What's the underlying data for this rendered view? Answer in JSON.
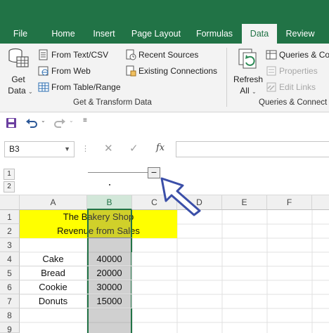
{
  "tabs": [
    {
      "label": "File",
      "active": false
    },
    {
      "label": "Home",
      "active": false
    },
    {
      "label": "Insert",
      "active": false
    },
    {
      "label": "Page Layout",
      "active": false
    },
    {
      "label": "Formulas",
      "active": false
    },
    {
      "label": "Data",
      "active": true
    },
    {
      "label": "Review",
      "active": false
    }
  ],
  "ribbon": {
    "get_data_line1": "Get",
    "get_data_line2": "Data",
    "from_text_csv": "From Text/CSV",
    "from_web": "From Web",
    "from_table_range": "From Table/Range",
    "recent_sources": "Recent Sources",
    "existing_connections": "Existing Connections",
    "group_get_transform": "Get & Transform Data",
    "refresh_line1": "Refresh",
    "refresh_line2": "All",
    "queries_connections": "Queries & Co",
    "properties": "Properties",
    "edit_links": "Edit Links",
    "group_queries": "Queries & Connect"
  },
  "formula_bar": {
    "name_box": "B3",
    "fx_label": "fx"
  },
  "outline": {
    "levels": [
      "1",
      "2"
    ],
    "collapse_symbol": "−"
  },
  "columns": [
    "A",
    "B",
    "C",
    "D",
    "E",
    "F"
  ],
  "rows": [
    "1",
    "2",
    "3",
    "4",
    "5",
    "6",
    "7",
    "8",
    "9"
  ],
  "sheet": {
    "title1": "The Bakery Shop",
    "title2": "Revenue from Sales",
    "items": [
      {
        "name": "Cake",
        "value": "40000"
      },
      {
        "name": "Bread",
        "value": "20000"
      },
      {
        "name": "Cookie",
        "value": "30000"
      },
      {
        "name": "Donuts",
        "value": "15000"
      }
    ]
  },
  "colors": {
    "accent": "#217346",
    "highlight": "#ffff00",
    "selection": "#bfbfbf"
  }
}
